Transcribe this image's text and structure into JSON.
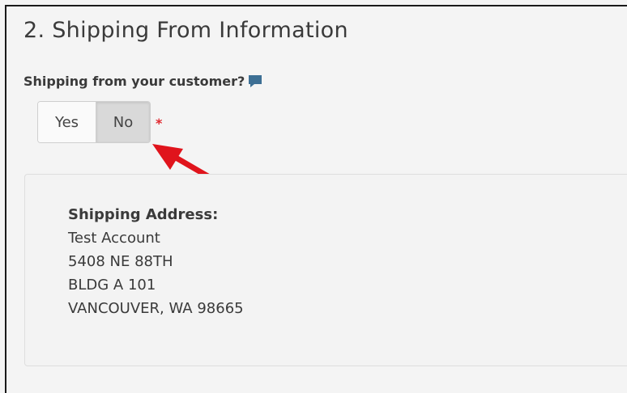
{
  "section": {
    "title": "2. Shipping From Information"
  },
  "question": {
    "label": "Shipping from your customer?",
    "icon": "comment-icon"
  },
  "toggle": {
    "options": [
      "Yes",
      "No"
    ],
    "selected": "No",
    "required_marker": "*"
  },
  "address": {
    "heading": "Shipping Address:",
    "lines": [
      "Test Account",
      "5408 NE 88TH",
      "BLDG A 101",
      "VANCOUVER, WA 98665"
    ]
  },
  "colors": {
    "required": "#e0282e",
    "arrow": "#e0141c",
    "icon": "#3d6f94"
  }
}
